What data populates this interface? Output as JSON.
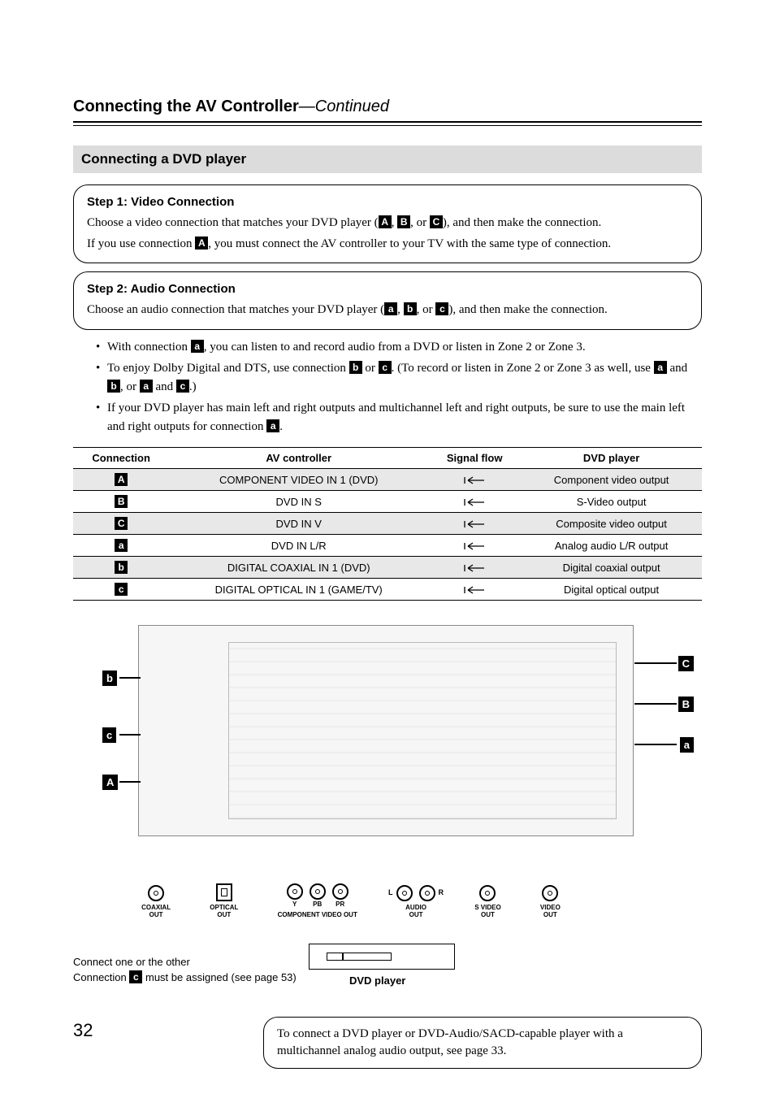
{
  "page": {
    "number": "32",
    "title_main": "Connecting the AV Controller",
    "title_cont": "—Continued"
  },
  "section": {
    "heading": "Connecting a DVD player"
  },
  "step1": {
    "heading": "Step 1: Video Connection",
    "line1_pre": "Choose a video connection that matches your DVD player (",
    "line1_sep1": ", ",
    "line1_sep2": ", or ",
    "line1_post": "), and then make the connection.",
    "line2_pre": "If you use connection ",
    "line2_post": ", you must connect the AV controller to your TV with the same type of connection."
  },
  "step2": {
    "heading": "Step 2: Audio Connection",
    "line1_pre": "Choose an audio connection that matches your DVD player (",
    "line1_sep1": ", ",
    "line1_sep2": ", or ",
    "line1_post": "), and then make the connection."
  },
  "chips": {
    "A": "A",
    "B": "B",
    "C": "C",
    "a": "a",
    "b": "b",
    "c": "c"
  },
  "bullets": {
    "b1_pre": "With connection ",
    "b1_post": ", you can listen to and record audio from a DVD or listen in Zone 2 or Zone 3.",
    "b2_pre": "To enjoy Dolby Digital and DTS, use connection ",
    "b2_mid1": " or ",
    "b2_mid2": ". (To record or listen in Zone 2 or Zone 3 as well, use ",
    "b2_mid3": " and ",
    "b2_mid4": ", or ",
    "b2_mid5": " and ",
    "b2_post": ".)",
    "b3_pre": "If your DVD player has main left and right outputs and multichannel left and right outputs, be sure to use the main left and right outputs for connection ",
    "b3_post": "."
  },
  "table": {
    "headers": {
      "connection": "Connection",
      "av_controller": "AV controller",
      "signal_flow": "Signal flow",
      "dvd_player": "DVD player"
    },
    "rows": [
      {
        "key": "A",
        "av": "COMPONENT VIDEO IN 1 (DVD)",
        "player": "Component video output",
        "shade": true
      },
      {
        "key": "B",
        "av": "DVD IN S",
        "player": "S-Video output",
        "shade": false
      },
      {
        "key": "C",
        "av": "DVD IN V",
        "player": "Composite video output",
        "shade": true
      },
      {
        "key": "a",
        "av": "DVD IN L/R",
        "player": "Analog audio L/R output",
        "shade": false
      },
      {
        "key": "b",
        "av": "DIGITAL COAXIAL IN 1 (DVD)",
        "player": "Digital coaxial output",
        "shade": true
      },
      {
        "key": "c",
        "av": "DIGITAL OPTICAL IN 1 (GAME/TV)",
        "player": "Digital optical output",
        "shade": false
      }
    ]
  },
  "diagram": {
    "jacks": {
      "coaxial": "COAXIAL\nOUT",
      "optical": "OPTICAL\nOUT",
      "y": "Y",
      "pb": "PB",
      "pr": "PR",
      "component_label": "COMPONENT VIDEO OUT",
      "audio": "AUDIO\nOUT",
      "audio_l": "L",
      "audio_r": "R",
      "svideo": "S VIDEO\nOUT",
      "video": "VIDEO\nOUT"
    },
    "player_caption": "DVD player",
    "connect_note_l1": "Connect one or the other",
    "connect_note_l2_pre": "Connection ",
    "connect_note_l2_post": " must be assigned (see page 53)"
  },
  "bottom_note": {
    "text": "To connect a DVD player or DVD-Audio/SACD-capable player with a multichannel analog audio output, see page 33."
  }
}
